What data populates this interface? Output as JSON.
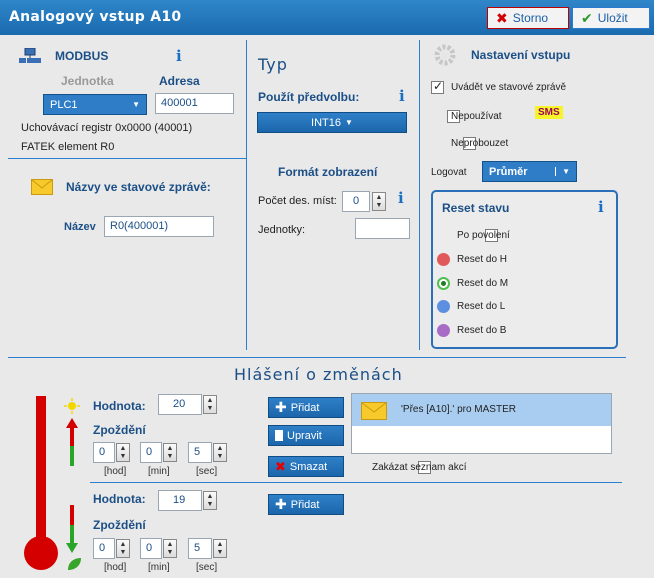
{
  "window": {
    "title": "Analogový vstup A10",
    "storno_label": "Storno",
    "ulozit_label": "Uložit"
  },
  "modbus": {
    "title": "MODBUS",
    "jednotka_label": "Jednotka",
    "adresa_label": "Adresa",
    "jednotka_value": "PLC1",
    "adresa_value": "400001",
    "register_text": "Uchovávací registr 0x0000 (40001)",
    "fatek_text": "FATEK element R0"
  },
  "nazvy": {
    "title": "Názvy ve stavové zprávě:",
    "nazev_label": "Název",
    "nazev_value": "R0(400001)"
  },
  "typ": {
    "title": "Typ",
    "predvolba_label": "Použít předvolbu:",
    "predvolba_value": "INT16",
    "format_title": "Formát zobrazení",
    "pocet_label": "Počet des. míst:",
    "pocet_value": "0",
    "jednotky_label": "Jednotky:",
    "jednotky_value": ""
  },
  "nastaveni": {
    "title": "Nastavení vstupu",
    "uvadet_label": "Uvádět ve stavové zprávě",
    "nepouzivat_label": "Nepoužívat",
    "sms_badge": "SMS",
    "neprobouzet_label": "Neprobouzet",
    "logovat_label": "Logovat",
    "logovat_value": "Průměr"
  },
  "reset": {
    "title": "Reset stavu",
    "po_povoleni_label": "Po povolení",
    "options": [
      "Reset do H",
      "Reset do M",
      "Reset do L",
      "Reset do B"
    ],
    "colors": [
      "#e05a5a",
      "#4fbf4f",
      "#5d8fe0",
      "#a86cc7"
    ],
    "selected": "Reset do M"
  },
  "hlaseni": {
    "title": "Hlášení o změnách",
    "upper": {
      "hodnota_label": "Hodnota:",
      "hodnota_value": "20",
      "zpozdeni_label": "Zpoždění",
      "hod": "0",
      "min": "0",
      "sec": "5",
      "hod_label": "[hod]",
      "min_label": "[min]",
      "sec_label": "[sec]"
    },
    "lower": {
      "hodnota_label": "Hodnota:",
      "hodnota_value": "19",
      "zpozdeni_label": "Zpoždění",
      "hod": "0",
      "min": "0",
      "sec": "5",
      "hod_label": "[hod]",
      "min_label": "[min]",
      "sec_label": "[sec]"
    },
    "pridat_label": "Přidat",
    "upravit_label": "Upravit",
    "smazat_label": "Smazat",
    "action_item": "'Přes [A10].' pro MASTER",
    "zakazat_label": "Zakázat seznam akcí",
    "pridat2_label": "Přidat"
  }
}
